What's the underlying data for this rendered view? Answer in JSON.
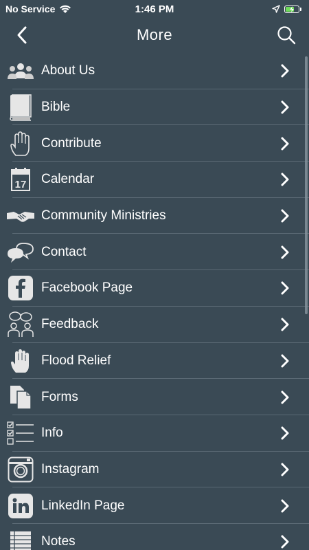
{
  "status": {
    "carrier": "No Service",
    "time": "1:46 PM"
  },
  "nav": {
    "title": "More"
  },
  "items": [
    {
      "label": "About Us",
      "icon": "people-icon"
    },
    {
      "label": "Bible",
      "icon": "book-icon"
    },
    {
      "label": "Contribute",
      "icon": "hand-outline-icon"
    },
    {
      "label": "Calendar",
      "icon": "calendar-icon"
    },
    {
      "label": "Community Ministries",
      "icon": "handshake-icon"
    },
    {
      "label": "Contact",
      "icon": "speech-bubbles-icon"
    },
    {
      "label": "Facebook Page",
      "icon": "facebook-icon"
    },
    {
      "label": "Feedback",
      "icon": "people-talking-icon"
    },
    {
      "label": "Flood Relief",
      "icon": "hand-icon"
    },
    {
      "label": "Forms",
      "icon": "documents-icon"
    },
    {
      "label": "Info",
      "icon": "checklist-icon"
    },
    {
      "label": "Instagram",
      "icon": "instagram-icon"
    },
    {
      "label": "LinkedIn Page",
      "icon": "linkedin-icon"
    },
    {
      "label": "Notes",
      "icon": "notes-icon"
    }
  ],
  "calendar_day": "17",
  "colors": {
    "background": "#3a4a55",
    "text": "#ffffff",
    "divider": "#5b6a75",
    "icon": "#e6e6e6"
  }
}
